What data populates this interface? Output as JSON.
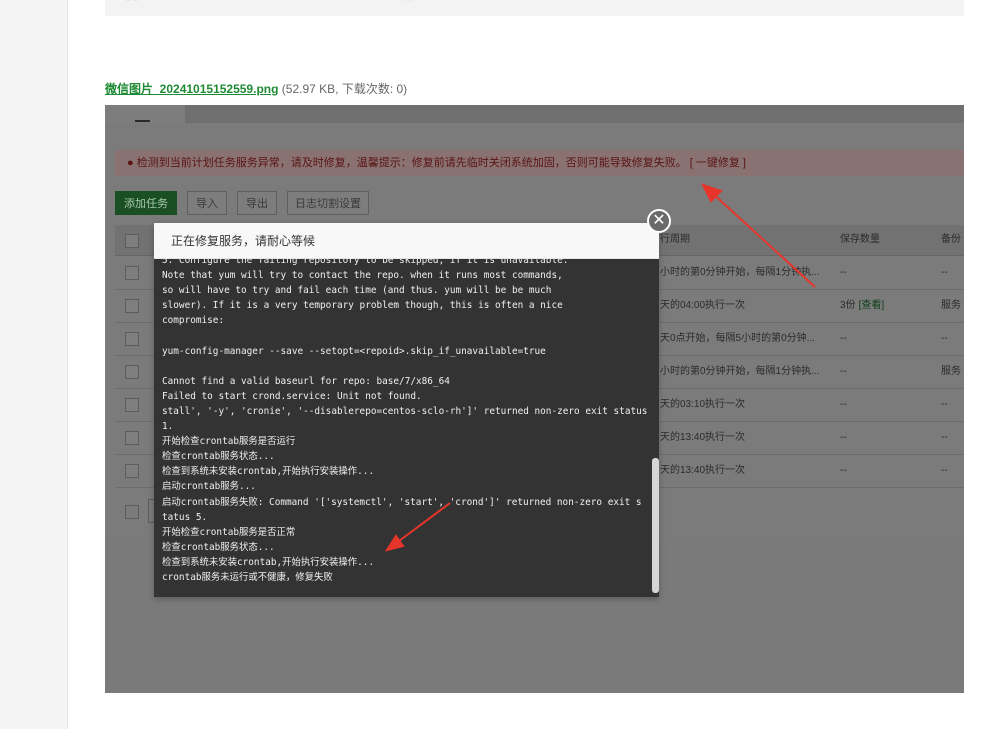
{
  "attachment": {
    "filename": "微信图片_20241015152559.png",
    "meta": "(52.97 KB, 下载次数: 0)"
  },
  "app": {
    "alert": "● 检测到当前计划任务服务异常，请及时修复，温馨提示：修复前请先临时关闭系统加固，否则可能导致修复失败。 [ 一键修复 ]",
    "toolbar": [
      "添加任务",
      "导入",
      "导出",
      "日志切割设置"
    ],
    "columns": [
      "行周期",
      "保存数量",
      "备份"
    ],
    "rows": [
      {
        "period": "小时的第0分钟开始，每隔1分钟执...",
        "count": "--",
        "backup": "--"
      },
      {
        "period": "天的04:00执行一次",
        "count": "3份",
        "count_link": "[查看]",
        "backup": "服务"
      },
      {
        "period": "天0点开始，每隔5小时的第0分钟...",
        "count": "--",
        "backup": "--"
      },
      {
        "period": "小时的第0分钟开始，每隔1分钟执...",
        "count": "--",
        "backup": "服务"
      },
      {
        "period": "天的03:10执行一次",
        "count": "--",
        "backup": "--"
      },
      {
        "period": "天的13:40执行一次",
        "count": "--",
        "backup": "--"
      },
      {
        "period": "天的13:40执行一次",
        "count": "--",
        "backup": "--"
      }
    ]
  },
  "dialog": {
    "title": "正在修复服务，请耐心等候",
    "close_icon": "close-circle-icon",
    "log": [
      "5. Configure the failing repository to be skipped, if it is unavailable.",
      "Note that yum will try to contact the repo. when it runs most commands,",
      "so will have to try and fail each time (and thus. yum will be be much",
      "slower). If it is a very temporary problem though, this is often a nice",
      "compromise:",
      "",
      "yum-config-manager --save --setopt=<repoid>.skip_if_unavailable=true",
      "",
      "Cannot find a valid baseurl for repo: base/7/x86_64",
      "Failed to start crond.service: Unit not found.",
      "stall', '-y', 'cronie', '--disablerepo=centos-sclo-rh']' returned non-zero exit status",
      "1.",
      "开始检查crontab服务是否运行",
      "检查crontab服务状态...",
      "检查到系统未安装crontab,开始执行安装操作...",
      "启动crontab服务...",
      "启动crontab服务失败: Command '['systemctl', 'start', 'crond']' returned non-zero exit s",
      "tatus 5.",
      "开始检查crontab服务是否正常",
      "检查crontab服务状态...",
      "检查到系统未安装crontab,开始执行安装操作...",
      "crontab服务未运行或不健康，修复失败"
    ]
  },
  "colors": {
    "link_green": "#1f8a35",
    "console_bg": "#333333",
    "arrow_red": "#e8352b"
  }
}
